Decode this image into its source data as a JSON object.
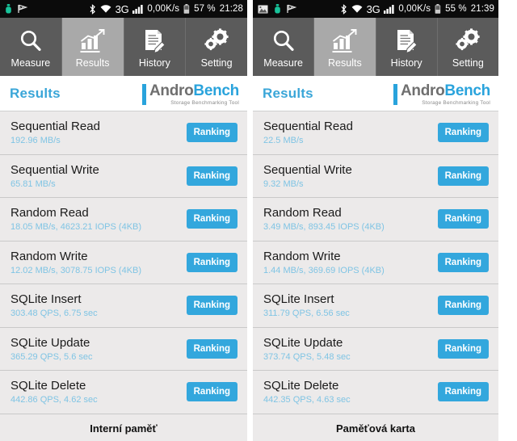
{
  "screens": [
    {
      "statusbar": {
        "left_icons": [
          "android-usb-icon",
          "flag-icon"
        ],
        "bluetooth_icon": "bluetooth-icon",
        "wifi_icon": "wifi-icon",
        "network_type": "3G",
        "signal_icon": "signal-bars-icon",
        "data_rate": "0,00K/s",
        "battery_icon": "battery-icon",
        "battery_percent": "57 %",
        "clock": "21:28"
      },
      "tabs": [
        {
          "label": "Measure",
          "icon": "magnifier-icon",
          "active": false
        },
        {
          "label": "Results",
          "icon": "bar-chart-icon",
          "active": true
        },
        {
          "label": "History",
          "icon": "document-pencil-icon",
          "active": false
        },
        {
          "label": "Setting",
          "icon": "gears-icon",
          "active": false
        }
      ],
      "appbar": {
        "title": "Results",
        "logo_word_1": "Andro",
        "logo_word_2": "Bench",
        "logo_subtitle": "Storage Benchmarking Tool"
      },
      "rows": [
        {
          "name": "Sequential Read",
          "value": "192.96 MB/s",
          "button": "Ranking"
        },
        {
          "name": "Sequential Write",
          "value": "65.81 MB/s",
          "button": "Ranking"
        },
        {
          "name": "Random Read",
          "value": "18.05 MB/s, 4623.21 IOPS (4KB)",
          "button": "Ranking"
        },
        {
          "name": "Random Write",
          "value": "12.02 MB/s, 3078.75 IOPS (4KB)",
          "button": "Ranking"
        },
        {
          "name": "SQLite Insert",
          "value": "303.48 QPS, 6.75 sec",
          "button": "Ranking"
        },
        {
          "name": "SQLite Update",
          "value": "365.29 QPS, 5.6 sec",
          "button": "Ranking"
        },
        {
          "name": "SQLite Delete",
          "value": "442.86 QPS, 4.62 sec",
          "button": "Ranking"
        }
      ],
      "caption": "Interní paměť"
    },
    {
      "statusbar": {
        "left_icons": [
          "image-icon",
          "android-usb-icon",
          "flag-icon"
        ],
        "bluetooth_icon": "bluetooth-icon",
        "wifi_icon": "wifi-icon",
        "network_type": "3G",
        "signal_icon": "signal-bars-icon",
        "data_rate": "0,00K/s",
        "battery_icon": "battery-icon",
        "battery_percent": "55 %",
        "clock": "21:39"
      },
      "tabs": [
        {
          "label": "Measure",
          "icon": "magnifier-icon",
          "active": false
        },
        {
          "label": "Results",
          "icon": "bar-chart-icon",
          "active": true
        },
        {
          "label": "History",
          "icon": "document-pencil-icon",
          "active": false
        },
        {
          "label": "Setting",
          "icon": "gears-icon",
          "active": false
        }
      ],
      "appbar": {
        "title": "Results",
        "logo_word_1": "Andro",
        "logo_word_2": "Bench",
        "logo_subtitle": "Storage Benchmarking Tool"
      },
      "rows": [
        {
          "name": "Sequential Read",
          "value": "22.5 MB/s",
          "button": "Ranking"
        },
        {
          "name": "Sequential Write",
          "value": "9.32 MB/s",
          "button": "Ranking"
        },
        {
          "name": "Random Read",
          "value": "3.49 MB/s, 893.45 IOPS (4KB)",
          "button": "Ranking"
        },
        {
          "name": "Random Write",
          "value": "1.44 MB/s, 369.69 IOPS (4KB)",
          "button": "Ranking"
        },
        {
          "name": "SQLite Insert",
          "value": "311.79 QPS, 6.56 sec",
          "button": "Ranking"
        },
        {
          "name": "SQLite Update",
          "value": "373.74 QPS, 5.48 sec",
          "button": "Ranking"
        },
        {
          "name": "SQLite Delete",
          "value": "442.35 QPS, 4.63 sec",
          "button": "Ranking"
        }
      ],
      "caption": "Paměťová karta"
    }
  ],
  "colors": {
    "accent_blue": "#33a7dd",
    "title_blue": "#3aa6d8",
    "value_blue": "#7fc4e4",
    "tabbar_gray": "#5b5b5b",
    "tab_active_gray": "#a9a9a9",
    "list_bg": "#eceaea",
    "statusbar_bg": "#0b0b0b"
  }
}
